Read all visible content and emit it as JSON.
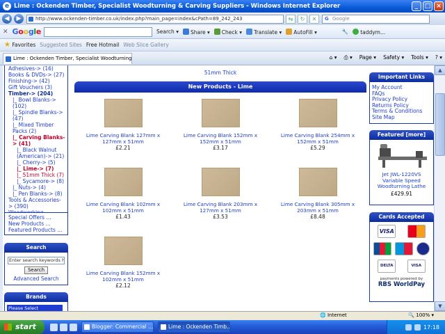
{
  "window": {
    "title": "Lime : Ockenden Timber, Specialist Woodturning & Carving Suppliers - Windows Internet Explorer"
  },
  "address": {
    "url": "http://www.ockenden-timber.co.uk/index.php?main_page=index&cPath=89_242_243",
    "search_placeholder": "Google"
  },
  "google_toolbar": {
    "logo": "Google",
    "search_label": "Search",
    "share_label": "Share",
    "check_label": "Check",
    "translate_label": "Translate",
    "autofill_label": "AutoFill",
    "user_label": "taddym..."
  },
  "favorites": {
    "label": "Favorites",
    "items": [
      "Suggested Sites",
      "Free Hotmail",
      "Web Slice Gallery"
    ]
  },
  "tab": {
    "title": "Lime : Ockenden Timber, Specialist Woodturning & Ca..."
  },
  "commands": [
    "Page",
    "Safety",
    "Tools"
  ],
  "categories": [
    {
      "text": "Adhesives-> (16)",
      "style": ""
    },
    {
      "text": "Books & DVDs-> (27)",
      "style": ""
    },
    {
      "text": "Finishing-> (42)",
      "style": ""
    },
    {
      "text": "Gift Vouchers (3)",
      "style": ""
    },
    {
      "text": "Timber-> (204)",
      "style": "bold"
    },
    {
      "text": "|_ Bowl Blanks-> (102)",
      "style": "ind1"
    },
    {
      "text": "|_ Spindle Blanks-> (47)",
      "style": "ind1"
    },
    {
      "text": "|_ Mixed Timber Packs (2)",
      "style": "ind1"
    },
    {
      "text": "|_ Carving Blanks-> (41)",
      "style": "ind1 redb"
    },
    {
      "text": "|_ Black Walnut (American)-> (21)",
      "style": "ind2"
    },
    {
      "text": "|_ Cherry-> (5)",
      "style": "ind2"
    },
    {
      "text": "|_ Lime-> (7)",
      "style": "ind2 redb"
    },
    {
      "text": "|_ 51mm Thick (7)",
      "style": "ind2 red"
    },
    {
      "text": "|_ Sycamore-> (8)",
      "style": "ind2"
    },
    {
      "text": "|_ Nuts-> (4)",
      "style": "ind1"
    },
    {
      "text": "|_ Pen Blanks-> (8)",
      "style": "ind1"
    },
    {
      "text": "Tools & Accessories-> (390)",
      "style": ""
    },
    {
      "text": "Woodworking Machinery-> (24)",
      "style": ""
    }
  ],
  "extras": [
    "Special Offers ...",
    "New Products ...",
    "Featured Products ..."
  ],
  "search_box": {
    "heading": "Search",
    "placeholder": "Enter search keywords he",
    "button": "Search",
    "advanced": "Advanced Search"
  },
  "brands_box": {
    "heading": "Brands",
    "selected": "Please Select"
  },
  "center": {
    "top_link": "51mm Thick",
    "heading": "New Products - Lime",
    "products": [
      {
        "name": "Lime Carving Blank 127mm x 127mm x 51mm",
        "price": "£2.21"
      },
      {
        "name": "Lime Carving Blank 152mm x 152mm x 51mm",
        "price": "£3.17"
      },
      {
        "name": "Lime Carving Blank 254mm x 152mm x 51mm",
        "price": "£5.29"
      },
      {
        "name": "Lime Carving Blank 102mm x 102mm x 51mm",
        "price": "£1.43"
      },
      {
        "name": "Lime Carving Blank 203mm x 127mm x 51mm",
        "price": "£3.53"
      },
      {
        "name": "Lime Carving Blank 305mm x 203mm x 51mm",
        "price": "£8.48"
      },
      {
        "name": "Lime Carving Blank 152mm x 102mm x 51mm",
        "price": "£2.12"
      }
    ]
  },
  "important_links": {
    "heading": "Important Links",
    "items": [
      "My Account",
      "FAQs",
      "Privacy Policy",
      "Returns Policy",
      "Terms & Conditions",
      "Site Map"
    ]
  },
  "featured": {
    "heading": "Featured  [more]",
    "name": "Jet JWL-1220VS Variable Speed Woodturning Lathe",
    "price": "£429.91"
  },
  "cards": {
    "heading": "Cards Accepted",
    "labels": [
      "VISA",
      "MasterCard",
      "JCB",
      "Maestro",
      "SOLO",
      "DELTA",
      "VISA Electron"
    ],
    "powered_small": "payments powered by",
    "powered_big": "RBS WorldPay"
  },
  "status": {
    "zone": "Internet",
    "zoom": "100%"
  },
  "taskbar": {
    "start": "start",
    "tasks": [
      "Blogger: Commercial ...",
      "Lime : Ockenden Timb..."
    ],
    "clock": "17:18"
  }
}
